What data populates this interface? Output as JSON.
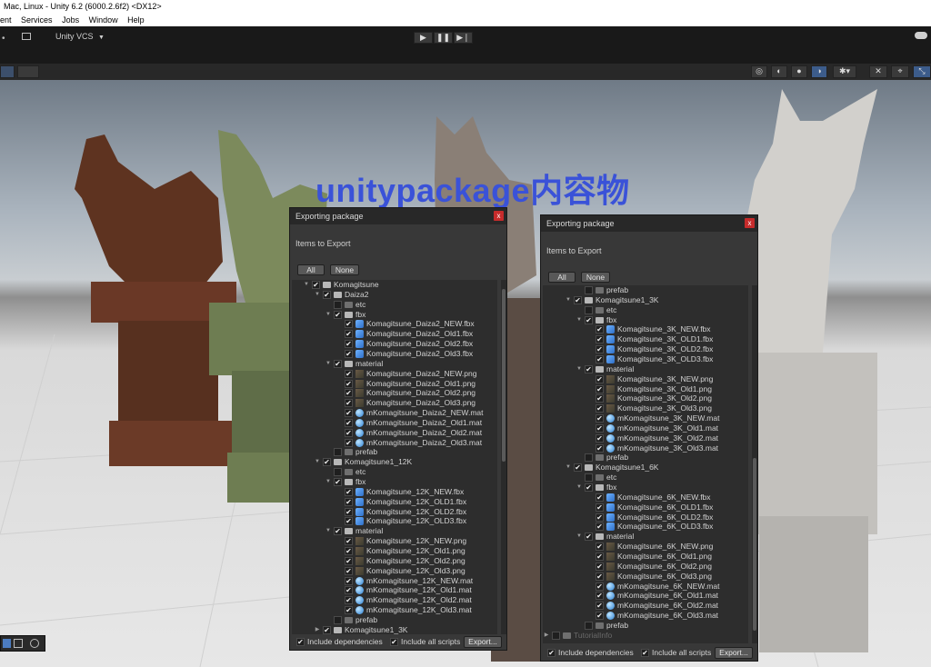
{
  "window": {
    "title": "Mac, Linux - Unity 6.2 (6000.2.6f2) <DX12>"
  },
  "menu": [
    "ent",
    "Services",
    "Jobs",
    "Window",
    "Help"
  ],
  "toolbar": {
    "vcs_label": "Unity VCS",
    "account_icon": "cloud-icon"
  },
  "scene": {
    "banner_text": "unitypackage内容物"
  },
  "panel_left": {
    "title": "Exporting package",
    "subtitle": "Items to Export",
    "all_label": "All",
    "none_label": "None",
    "close_label": "x",
    "include_dependencies": "Include dependencies",
    "include_scripts": "Include all scripts",
    "export_label": "Export...",
    "rows": [
      {
        "indent": 1,
        "arrow": "▼",
        "checked": true,
        "icon": "folder",
        "label": "Komagitsune"
      },
      {
        "indent": 2,
        "arrow": "▼",
        "checked": true,
        "icon": "folder",
        "label": "Daiza2"
      },
      {
        "indent": 3,
        "arrow": "",
        "checked": false,
        "icon": "folder-dim",
        "label": "etc"
      },
      {
        "indent": 3,
        "arrow": "▼",
        "checked": true,
        "icon": "folder",
        "label": "fbx"
      },
      {
        "indent": 4,
        "arrow": "",
        "checked": true,
        "icon": "fbx",
        "label": "Komagitsune_Daiza2_NEW.fbx"
      },
      {
        "indent": 4,
        "arrow": "",
        "checked": true,
        "icon": "fbx",
        "label": "Komagitsune_Daiza2_Old1.fbx"
      },
      {
        "indent": 4,
        "arrow": "",
        "checked": true,
        "icon": "fbx",
        "label": "Komagitsune_Daiza2_Old2.fbx"
      },
      {
        "indent": 4,
        "arrow": "",
        "checked": true,
        "icon": "fbx",
        "label": "Komagitsune_Daiza2_Old3.fbx"
      },
      {
        "indent": 3,
        "arrow": "▼",
        "checked": true,
        "icon": "folder",
        "label": "material"
      },
      {
        "indent": 4,
        "arrow": "",
        "checked": true,
        "icon": "png",
        "label": "Komagitsune_Daiza2_NEW.png"
      },
      {
        "indent": 4,
        "arrow": "",
        "checked": true,
        "icon": "png",
        "label": "Komagitsune_Daiza2_Old1.png"
      },
      {
        "indent": 4,
        "arrow": "",
        "checked": true,
        "icon": "png",
        "label": "Komagitsune_Daiza2_Old2.png"
      },
      {
        "indent": 4,
        "arrow": "",
        "checked": true,
        "icon": "png",
        "label": "Komagitsune_Daiza2_Old3.png"
      },
      {
        "indent": 4,
        "arrow": "",
        "checked": true,
        "icon": "mat",
        "label": "mKomagitsune_Daiza2_NEW.mat"
      },
      {
        "indent": 4,
        "arrow": "",
        "checked": true,
        "icon": "mat",
        "label": "mKomagitsune_Daiza2_Old1.mat"
      },
      {
        "indent": 4,
        "arrow": "",
        "checked": true,
        "icon": "mat",
        "label": "mKomagitsune_Daiza2_Old2.mat"
      },
      {
        "indent": 4,
        "arrow": "",
        "checked": true,
        "icon": "mat",
        "label": "mKomagitsune_Daiza2_Old3.mat"
      },
      {
        "indent": 3,
        "arrow": "",
        "checked": false,
        "icon": "folder-dim",
        "label": "prefab"
      },
      {
        "indent": 2,
        "arrow": "▼",
        "checked": true,
        "icon": "folder",
        "label": "Komagitsune1_12K"
      },
      {
        "indent": 3,
        "arrow": "",
        "checked": false,
        "icon": "folder-dim",
        "label": "etc"
      },
      {
        "indent": 3,
        "arrow": "▼",
        "checked": true,
        "icon": "folder",
        "label": "fbx"
      },
      {
        "indent": 4,
        "arrow": "",
        "checked": true,
        "icon": "fbx",
        "label": "Komagitsune_12K_NEW.fbx"
      },
      {
        "indent": 4,
        "arrow": "",
        "checked": true,
        "icon": "fbx",
        "label": "Komagitsune_12K_OLD1.fbx"
      },
      {
        "indent": 4,
        "arrow": "",
        "checked": true,
        "icon": "fbx",
        "label": "Komagitsune_12K_OLD2.fbx"
      },
      {
        "indent": 4,
        "arrow": "",
        "checked": true,
        "icon": "fbx",
        "label": "Komagitsune_12K_OLD3.fbx"
      },
      {
        "indent": 3,
        "arrow": "▼",
        "checked": true,
        "icon": "folder",
        "label": "material"
      },
      {
        "indent": 4,
        "arrow": "",
        "checked": true,
        "icon": "png",
        "label": "Komagitsune_12K_NEW.png"
      },
      {
        "indent": 4,
        "arrow": "",
        "checked": true,
        "icon": "png",
        "label": "Komagitsune_12K_Old1.png"
      },
      {
        "indent": 4,
        "arrow": "",
        "checked": true,
        "icon": "png",
        "label": "Komagitsune_12K_Old2.png"
      },
      {
        "indent": 4,
        "arrow": "",
        "checked": true,
        "icon": "png",
        "label": "Komagitsune_12K_Old3.png"
      },
      {
        "indent": 4,
        "arrow": "",
        "checked": true,
        "icon": "mat",
        "label": "mKomagitsune_12K_NEW.mat"
      },
      {
        "indent": 4,
        "arrow": "",
        "checked": true,
        "icon": "mat",
        "label": "mKomagitsune_12K_Old1.mat"
      },
      {
        "indent": 4,
        "arrow": "",
        "checked": true,
        "icon": "mat",
        "label": "mKomagitsune_12K_Old2.mat"
      },
      {
        "indent": 4,
        "arrow": "",
        "checked": true,
        "icon": "mat",
        "label": "mKomagitsune_12K_Old3.mat"
      },
      {
        "indent": 3,
        "arrow": "",
        "checked": false,
        "icon": "folder-dim",
        "label": "prefab"
      },
      {
        "indent": 2,
        "arrow": "▶",
        "checked": true,
        "icon": "folder",
        "label": "Komagitsune1_3K"
      }
    ]
  },
  "panel_right": {
    "title": "Exporting package",
    "subtitle": "Items to Export",
    "all_label": "All",
    "none_label": "None",
    "close_label": "x",
    "include_dependencies": "Include dependencies",
    "include_scripts": "Include all scripts",
    "export_label": "Export...",
    "rows": [
      {
        "indent": 3,
        "arrow": "",
        "checked": false,
        "icon": "folder-dim",
        "label": "prefab"
      },
      {
        "indent": 2,
        "arrow": "▼",
        "checked": true,
        "icon": "folder",
        "label": "Komagitsune1_3K"
      },
      {
        "indent": 3,
        "arrow": "",
        "checked": false,
        "icon": "folder-dim",
        "label": "etc"
      },
      {
        "indent": 3,
        "arrow": "▼",
        "checked": true,
        "icon": "folder",
        "label": "fbx"
      },
      {
        "indent": 4,
        "arrow": "",
        "checked": true,
        "icon": "fbx",
        "label": "Komagitsune_3K_NEW.fbx"
      },
      {
        "indent": 4,
        "arrow": "",
        "checked": true,
        "icon": "fbx",
        "label": "Komagitsune_3K_OLD1.fbx"
      },
      {
        "indent": 4,
        "arrow": "",
        "checked": true,
        "icon": "fbx",
        "label": "Komagitsune_3K_OLD2.fbx"
      },
      {
        "indent": 4,
        "arrow": "",
        "checked": true,
        "icon": "fbx",
        "label": "Komagitsune_3K_OLD3.fbx"
      },
      {
        "indent": 3,
        "arrow": "▼",
        "checked": true,
        "icon": "folder",
        "label": "material"
      },
      {
        "indent": 4,
        "arrow": "",
        "checked": true,
        "icon": "png",
        "label": "Komagitsune_3K_NEW.png"
      },
      {
        "indent": 4,
        "arrow": "",
        "checked": true,
        "icon": "png",
        "label": "Komagitsune_3K_Old1.png"
      },
      {
        "indent": 4,
        "arrow": "",
        "checked": true,
        "icon": "png",
        "label": "Komagitsune_3K_Old2.png"
      },
      {
        "indent": 4,
        "arrow": "",
        "checked": true,
        "icon": "png",
        "label": "Komagitsune_3K_Old3.png"
      },
      {
        "indent": 4,
        "arrow": "",
        "checked": true,
        "icon": "mat",
        "label": "mKomagitsune_3K_NEW.mat"
      },
      {
        "indent": 4,
        "arrow": "",
        "checked": true,
        "icon": "mat",
        "label": "mKomagitsune_3K_Old1.mat"
      },
      {
        "indent": 4,
        "arrow": "",
        "checked": true,
        "icon": "mat",
        "label": "mKomagitsune_3K_Old2.mat"
      },
      {
        "indent": 4,
        "arrow": "",
        "checked": true,
        "icon": "mat",
        "label": "mKomagitsune_3K_Old3.mat"
      },
      {
        "indent": 3,
        "arrow": "",
        "checked": false,
        "icon": "folder-dim",
        "label": "prefab"
      },
      {
        "indent": 2,
        "arrow": "▼",
        "checked": true,
        "icon": "folder",
        "label": "Komagitsune1_6K"
      },
      {
        "indent": 3,
        "arrow": "",
        "checked": false,
        "icon": "folder-dim",
        "label": "etc"
      },
      {
        "indent": 3,
        "arrow": "▼",
        "checked": true,
        "icon": "folder",
        "label": "fbx"
      },
      {
        "indent": 4,
        "arrow": "",
        "checked": true,
        "icon": "fbx",
        "label": "Komagitsune_6K_NEW.fbx"
      },
      {
        "indent": 4,
        "arrow": "",
        "checked": true,
        "icon": "fbx",
        "label": "Komagitsune_6K_OLD1.fbx"
      },
      {
        "indent": 4,
        "arrow": "",
        "checked": true,
        "icon": "fbx",
        "label": "Komagitsune_6K_OLD2.fbx"
      },
      {
        "indent": 4,
        "arrow": "",
        "checked": true,
        "icon": "fbx",
        "label": "Komagitsune_6K_OLD3.fbx"
      },
      {
        "indent": 3,
        "arrow": "▼",
        "checked": true,
        "icon": "folder",
        "label": "material"
      },
      {
        "indent": 4,
        "arrow": "",
        "checked": true,
        "icon": "png",
        "label": "Komagitsune_6K_NEW.png"
      },
      {
        "indent": 4,
        "arrow": "",
        "checked": true,
        "icon": "png",
        "label": "Komagitsune_6K_Old1.png"
      },
      {
        "indent": 4,
        "arrow": "",
        "checked": true,
        "icon": "png",
        "label": "Komagitsune_6K_Old2.png"
      },
      {
        "indent": 4,
        "arrow": "",
        "checked": true,
        "icon": "png",
        "label": "Komagitsune_6K_Old3.png"
      },
      {
        "indent": 4,
        "arrow": "",
        "checked": true,
        "icon": "mat",
        "label": "mKomagitsune_6K_NEW.mat"
      },
      {
        "indent": 4,
        "arrow": "",
        "checked": true,
        "icon": "mat",
        "label": "mKomagitsune_6K_Old1.mat"
      },
      {
        "indent": 4,
        "arrow": "",
        "checked": true,
        "icon": "mat",
        "label": "mKomagitsune_6K_Old2.mat"
      },
      {
        "indent": 4,
        "arrow": "",
        "checked": true,
        "icon": "mat",
        "label": "mKomagitsune_6K_Old3.mat"
      },
      {
        "indent": 3,
        "arrow": "",
        "checked": false,
        "icon": "folder-dim",
        "label": "prefab"
      },
      {
        "indent": 0,
        "arrow": "▶",
        "checked": false,
        "icon": "folder-dim",
        "label": "TutorialInfo"
      }
    ]
  },
  "colors": {
    "banner": "#3a52d8",
    "close": "#c62b2b",
    "panel": "#383838",
    "tree": "#2d2d2d"
  }
}
